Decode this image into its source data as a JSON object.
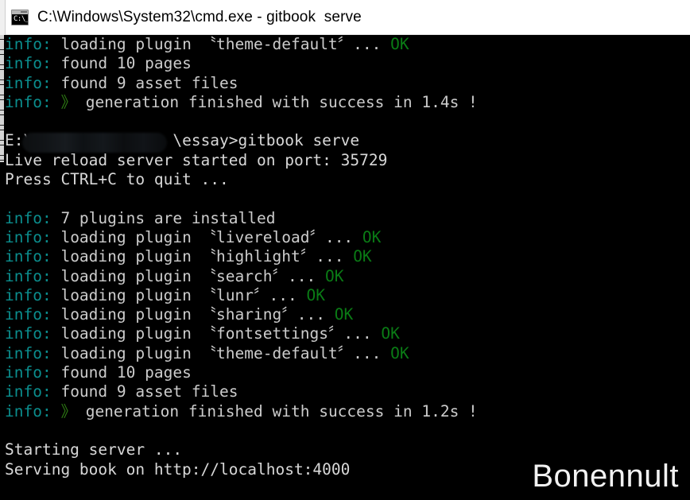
{
  "window": {
    "title": "C:\\Windows\\System32\\cmd.exe - gitbook  serve",
    "icon": "cmd-console-icon",
    "icon_glyph": "C:\\_",
    "background_color": "#000000",
    "titlebar_color": "#ffffff"
  },
  "colors": {
    "info_prefix": "#0b8d8d",
    "ok_status": "#0a7b15",
    "arrow": "#2f7d14",
    "body_text": "#cccccc",
    "background": "#000000"
  },
  "console": {
    "lines": [
      {
        "id": "l1",
        "type": "info",
        "prefix": "info: ",
        "text": "loading plugin 〝theme-default〞... ",
        "status": "OK"
      },
      {
        "id": "l2",
        "type": "info",
        "prefix": "info: ",
        "text": "found 10 pages",
        "status": ""
      },
      {
        "id": "l3",
        "type": "info",
        "prefix": "info: ",
        "text": "found 9 asset files",
        "status": ""
      },
      {
        "id": "l4",
        "type": "info-arrow",
        "prefix": "info: ",
        "arrow": "》 ",
        "text": "generation finished with success in 1.4s !",
        "status": ""
      },
      {
        "id": "l5",
        "type": "blank",
        "prefix": "",
        "text": "",
        "status": ""
      },
      {
        "id": "l6",
        "type": "prompt",
        "prefix": "",
        "text": "E:\\",
        "redacted": true,
        "text_after": "\\essay>gitbook serve",
        "status": ""
      },
      {
        "id": "l7",
        "type": "plain",
        "prefix": "",
        "text": "Live reload server started on port: 35729",
        "status": ""
      },
      {
        "id": "l8",
        "type": "plain",
        "prefix": "",
        "text": "Press CTRL+C to quit ...",
        "status": ""
      },
      {
        "id": "l9",
        "type": "blank",
        "prefix": "",
        "text": "",
        "status": ""
      },
      {
        "id": "l10",
        "type": "info",
        "prefix": "info: ",
        "text": "7 plugins are installed",
        "status": ""
      },
      {
        "id": "l11",
        "type": "info",
        "prefix": "info: ",
        "text": "loading plugin 〝livereload〞... ",
        "status": "OK"
      },
      {
        "id": "l12",
        "type": "info",
        "prefix": "info: ",
        "text": "loading plugin 〝highlight〞... ",
        "status": "OK"
      },
      {
        "id": "l13",
        "type": "info",
        "prefix": "info: ",
        "text": "loading plugin 〝search〞... ",
        "status": "OK"
      },
      {
        "id": "l14",
        "type": "info",
        "prefix": "info: ",
        "text": "loading plugin 〝lunr〞... ",
        "status": "OK"
      },
      {
        "id": "l15",
        "type": "info",
        "prefix": "info: ",
        "text": "loading plugin 〝sharing〞... ",
        "status": "OK"
      },
      {
        "id": "l16",
        "type": "info",
        "prefix": "info: ",
        "text": "loading plugin 〝fontsettings〞... ",
        "status": "OK"
      },
      {
        "id": "l17",
        "type": "info",
        "prefix": "info: ",
        "text": "loading plugin 〝theme-default〞... ",
        "status": "OK"
      },
      {
        "id": "l18",
        "type": "info",
        "prefix": "info: ",
        "text": "found 10 pages",
        "status": ""
      },
      {
        "id": "l19",
        "type": "info",
        "prefix": "info: ",
        "text": "found 9 asset files",
        "status": ""
      },
      {
        "id": "l20",
        "type": "info-arrow",
        "prefix": "info: ",
        "arrow": "》 ",
        "text": "generation finished with success in 1.2s !",
        "status": ""
      },
      {
        "id": "l21",
        "type": "blank",
        "prefix": "",
        "text": "",
        "status": ""
      },
      {
        "id": "l22",
        "type": "plain",
        "prefix": "",
        "text": "Starting server ...",
        "status": ""
      },
      {
        "id": "l23",
        "type": "plain",
        "prefix": "",
        "text": "Serving book on http://localhost:4000",
        "status": ""
      }
    ]
  },
  "watermark": {
    "text": "Bonennult"
  }
}
